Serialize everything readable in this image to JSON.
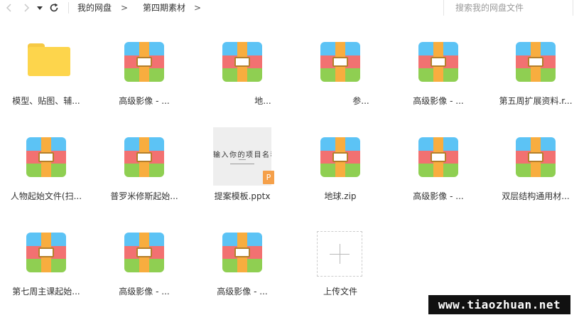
{
  "toolbar": {
    "icons": {
      "back": "chevron-left-icon",
      "forward": "chevron-right-icon",
      "history": "caret-down-icon",
      "refresh": "refresh-icon"
    },
    "breadcrumb": [
      {
        "label": "我的网盘"
      },
      {
        "label": "第四期素材"
      }
    ],
    "separator": ">",
    "search_placeholder": "搜索我的网盘文件"
  },
  "files": [
    {
      "name": "模型、贴图、辅...",
      "type": "folder"
    },
    {
      "name": "高级影像 - ...",
      "type": "zip"
    },
    {
      "name": "地...",
      "type": "zip"
    },
    {
      "name": "参...",
      "type": "zip"
    },
    {
      "name": "高级影像 - ...",
      "type": "zip"
    },
    {
      "name": "第五周扩展资料.r...",
      "type": "zip"
    },
    {
      "name": "人物起始文件(扫...",
      "type": "zip"
    },
    {
      "name": "普罗米修斯起始...",
      "type": "zip"
    },
    {
      "name": "提案模板.pptx",
      "type": "pptx",
      "thumb_text": "输入你的项目名称",
      "badge": "P"
    },
    {
      "name": "地球.zip",
      "type": "zip"
    },
    {
      "name": "高级影像 - ...",
      "type": "zip"
    },
    {
      "name": "双层结构通用材...",
      "type": "zip"
    },
    {
      "name": "第七周主课起始...",
      "type": "zip"
    },
    {
      "name": "高级影像 - ...",
      "type": "zip"
    },
    {
      "name": "高级影像 - ...",
      "type": "zip"
    }
  ],
  "upload": {
    "label": "上传文件",
    "icon": "plus-icon"
  },
  "watermark": "www.tiaozhuan.net",
  "colors": {
    "folder": "#fdd54c",
    "zip_blue": "#5cc3f5",
    "zip_red": "#f27171",
    "zip_green": "#8fcf52",
    "zip_strap": "#f8ad3f",
    "ppt_badge": "#f5a04a"
  }
}
